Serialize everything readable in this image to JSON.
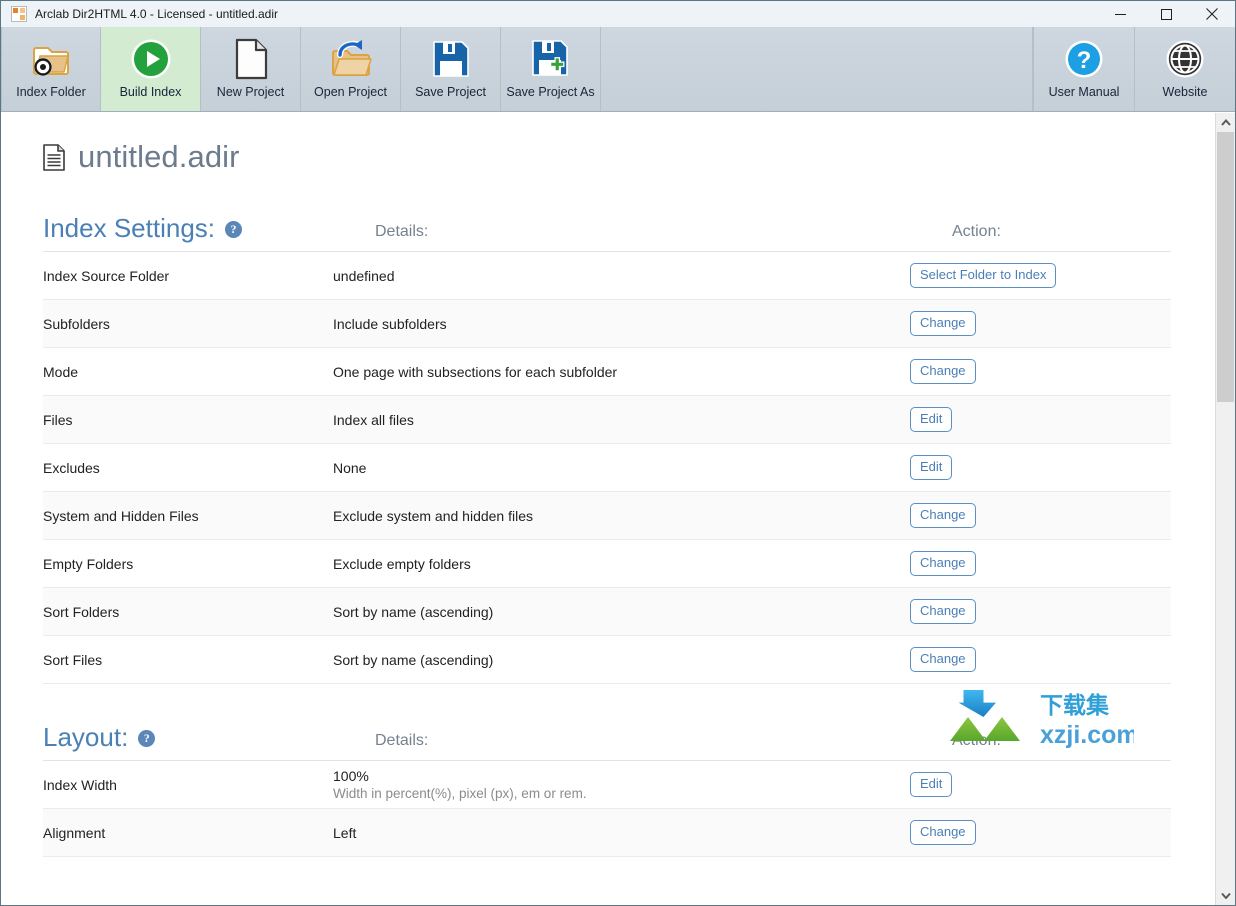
{
  "window": {
    "title": "Arclab Dir2HTML 4.0 - Licensed - untitled.adir",
    "app_icon": "arclab-app-icon",
    "controls": {
      "minimize": "minimize-button",
      "maximize": "maximize-button",
      "close": "close-button"
    }
  },
  "toolbar": {
    "buttons": [
      {
        "label": "Index Folder",
        "icon": "folder-target-icon",
        "active": false
      },
      {
        "label": "Build Index",
        "icon": "play-circle-icon",
        "active": true
      },
      {
        "label": "New Project",
        "icon": "page-icon",
        "active": false
      },
      {
        "label": "Open Project",
        "icon": "open-folder-arrow-icon",
        "active": false
      },
      {
        "label": "Save Project",
        "icon": "floppy-disk-icon",
        "active": false
      },
      {
        "label": "Save Project As",
        "icon": "floppy-disk-plus-icon",
        "active": false
      }
    ],
    "right_buttons": [
      {
        "label": "User Manual",
        "icon": "question-circle-icon"
      },
      {
        "label": "Website",
        "icon": "globe-icon"
      }
    ]
  },
  "document": {
    "title": "untitled.adir",
    "icon": "document-lines-icon"
  },
  "sections": [
    {
      "heading": "Index Settings:",
      "help": "?",
      "details_header": "Details:",
      "action_header": "Action:",
      "rows": [
        {
          "name": "Index Source Folder",
          "detail": "undefined",
          "detail_style": "green",
          "action": "Select Folder to Index"
        },
        {
          "name": "Subfolders",
          "detail": "Include subfolders",
          "detail_style": "green",
          "action": "Change"
        },
        {
          "name": "Mode",
          "detail": "One page with subsections for each subfolder",
          "detail_style": "green",
          "action": "Change"
        },
        {
          "name": "Files",
          "detail": "Index all files",
          "detail_style": "dark",
          "action": "Edit"
        },
        {
          "name": "Excludes",
          "detail": "None",
          "detail_style": "dark",
          "action": "Edit"
        },
        {
          "name": "System and Hidden Files",
          "detail": "Exclude system and hidden files",
          "detail_style": "dark",
          "action": "Change"
        },
        {
          "name": "Empty Folders",
          "detail": "Exclude empty folders",
          "detail_style": "dark",
          "action": "Change"
        },
        {
          "name": "Sort Folders",
          "detail": "Sort by name (ascending)",
          "detail_style": "dark",
          "action": "Change"
        },
        {
          "name": "Sort Files",
          "detail": "Sort by name (ascending)",
          "detail_style": "dark",
          "action": "Change"
        }
      ]
    },
    {
      "heading": "Layout:",
      "help": "?",
      "details_header": "Details:",
      "action_header": "Action:",
      "rows": [
        {
          "name": "Index Width",
          "detail": "100%",
          "sub_detail": "Width in percent(%), pixel (px), em or rem.",
          "detail_style": "dark",
          "action": "Edit"
        },
        {
          "name": "Alignment",
          "detail": "Left",
          "detail_style": "dark",
          "action": "Change"
        }
      ]
    }
  ],
  "watermark": {
    "cn_text": "下载集",
    "domain": "xzji.com"
  },
  "scrollbar": {
    "up_arrow": "chevron-up-icon",
    "down_arrow": "chevron-down-icon"
  },
  "colors": {
    "accent_blue": "#4a80b5",
    "green_value": "#3c9257",
    "title_gray": "#6d7b8d",
    "active_toolbar": "#d3ecd1"
  }
}
